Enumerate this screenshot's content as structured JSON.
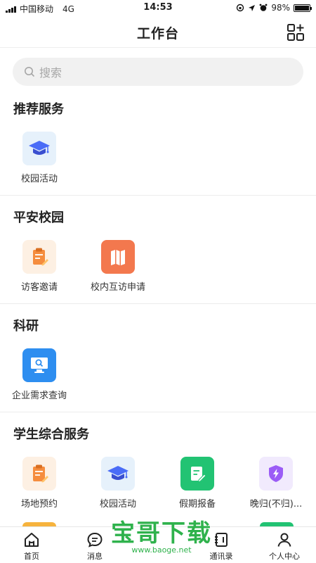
{
  "status_bar": {
    "carrier": "中国移动",
    "network": "4G",
    "time": "14:53",
    "battery": "98%",
    "battery_level": 0.98
  },
  "header": {
    "title": "工作台",
    "grid_icon": "apps-grid-icon"
  },
  "search": {
    "placeholder": "搜索",
    "icon": "search-icon"
  },
  "sections": [
    {
      "title": "推荐服务",
      "apps": [
        {
          "label": "校园活动",
          "icon": "graduation-cap-icon",
          "color": "#4a6cf7",
          "bg": "#e6f1fb"
        }
      ]
    },
    {
      "title": "平安校园",
      "apps": [
        {
          "label": "访客邀请",
          "icon": "clipboard-edit-icon",
          "color": "#f58d3e",
          "bg": "#fdf0e3"
        },
        {
          "label": "校内互访申请",
          "icon": "map-icon",
          "color": "#ffffff",
          "bg": "#f3784e"
        }
      ]
    },
    {
      "title": "科研",
      "apps": [
        {
          "label": "企业需求查询",
          "icon": "monitor-search-icon",
          "color": "#ffffff",
          "bg": "#2e8ef0"
        }
      ]
    },
    {
      "title": "学生综合服务",
      "apps": [
        {
          "label": "场地预约",
          "icon": "clipboard-edit-icon",
          "color": "#f58d3e",
          "bg": "#fdf0e3"
        },
        {
          "label": "校园活动",
          "icon": "graduation-cap-icon",
          "color": "#4a6cf7",
          "bg": "#e6f1fb"
        },
        {
          "label": "假期报备",
          "icon": "note-edit-icon",
          "color": "#ffffff",
          "bg": "#22c373"
        },
        {
          "label": "晚归(不归)...",
          "icon": "shield-bolt-icon",
          "color": "#9b5cf6",
          "bg": "#f1eafd"
        }
      ]
    }
  ],
  "tabbar": [
    {
      "label": "首页",
      "icon": "home-icon"
    },
    {
      "label": "消息",
      "icon": "message-icon"
    },
    {
      "label": "",
      "icon": ""
    },
    {
      "label": "通讯录",
      "icon": "contacts-icon"
    },
    {
      "label": "个人中心",
      "icon": "person-icon"
    }
  ],
  "watermark": {
    "title": "宝哥下载",
    "url": "www.baoge.net"
  }
}
